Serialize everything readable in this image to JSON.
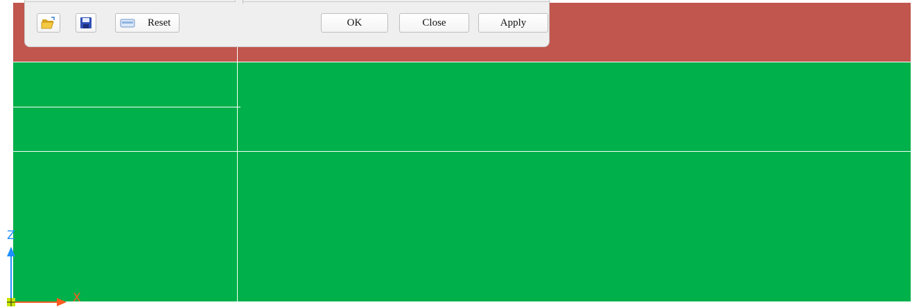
{
  "toolbar": {
    "open_icon": "folder-open-icon",
    "save_icon": "floppy-save-icon",
    "reset_icon": "reset-card-icon",
    "reset_label": "Reset"
  },
  "dialog_buttons": {
    "ok_label": "OK",
    "close_label": "Close",
    "apply_label": "Apply"
  },
  "axis": {
    "z_label": "Z",
    "x_label": "X",
    "z_color": "#1e90ff",
    "x_color": "#ff5a1f"
  },
  "colors": {
    "red_band": "#c0564e",
    "green_band": "#00b04a"
  }
}
